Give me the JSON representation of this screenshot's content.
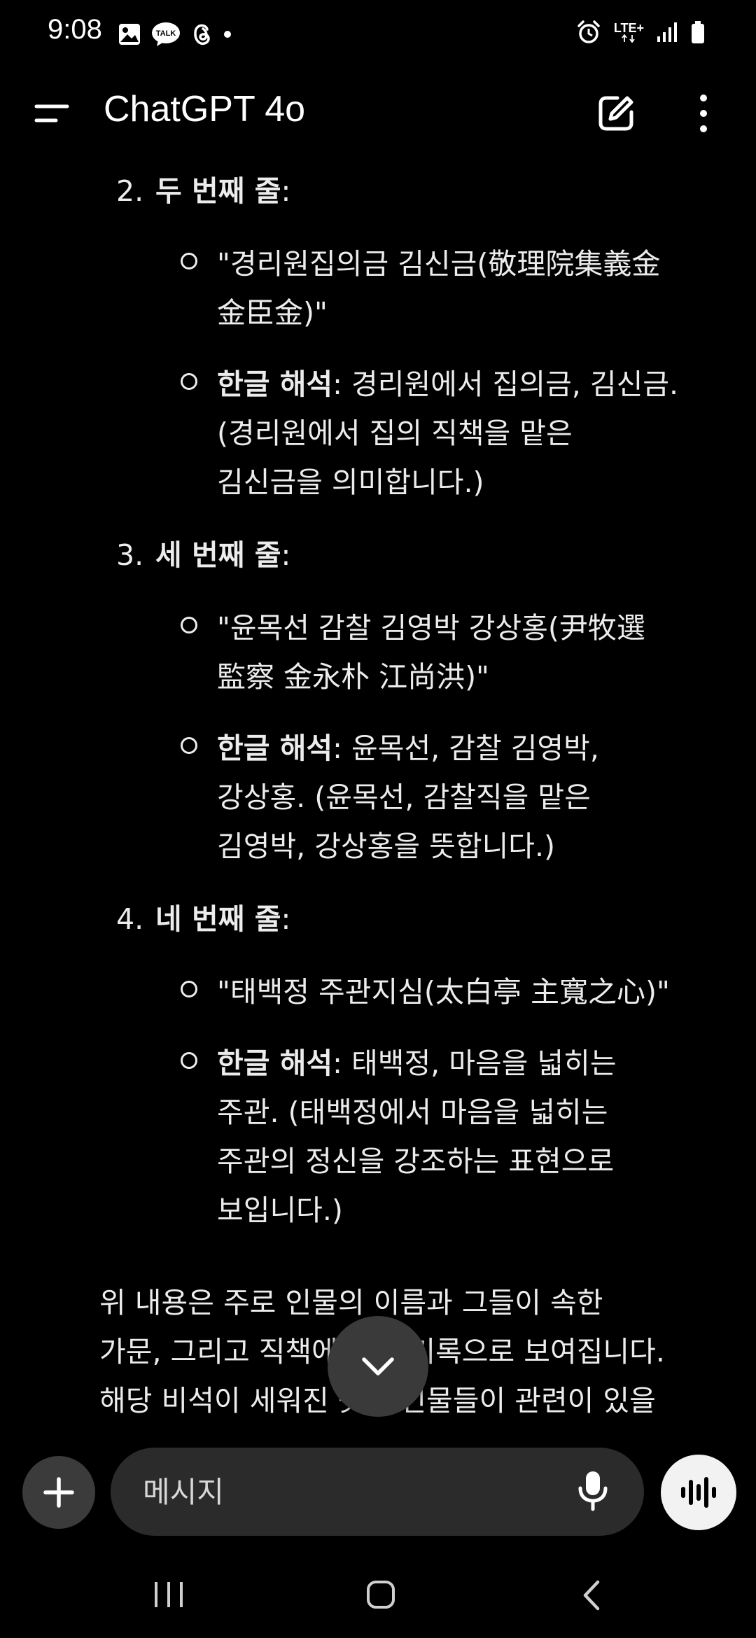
{
  "status_bar": {
    "time": "9:08",
    "left_icons": [
      "gallery-icon",
      "talk-icon",
      "threads-icon",
      "dot-icon"
    ],
    "talk_badge": "TALK",
    "network": "LTE+",
    "right_icons": [
      "alarm-icon",
      "lte-icon",
      "signal-icon",
      "battery-icon"
    ]
  },
  "app_bar": {
    "title": "ChatGPT 4o",
    "icons": [
      "menu-icon",
      "new-chat-icon",
      "more-vert-icon"
    ]
  },
  "message": {
    "items": [
      {
        "number": "2.",
        "heading": "두 번째 줄",
        "suffix": ":",
        "quote_lines": [
          "\"경리원집의금 김신금(敬理院集義金",
          "金臣金)\""
        ],
        "interp_label": "한글 해석",
        "interp_lines": [
          ": 경리원에서 집의금, 김신금.",
          "(경리원에서 집의 직책을 맡은",
          "김신금을 의미합니다.)"
        ]
      },
      {
        "number": "3.",
        "heading": "세 번째 줄",
        "suffix": ":",
        "quote_lines": [
          "\"윤목선 감찰 김영박 강상홍(尹牧選",
          "監察 金永朴 江尚洪)\""
        ],
        "interp_label": "한글 해석",
        "interp_lines": [
          ": 윤목선, 감찰 김영박,",
          "강상홍. (윤목선, 감찰직을 맡은",
          "김영박, 강상홍을 뜻합니다.)"
        ]
      },
      {
        "number": "4.",
        "heading": "네 번째 줄",
        "suffix": ":",
        "quote_lines": [
          "\"태백정 주관지심(太白亭 主寬之心)\""
        ],
        "interp_label": "한글 해석",
        "interp_lines": [
          ": 태백정, 마음을 넓히는",
          "주관. (태백정에서 마음을 넓히는",
          "주관의 정신을 강조하는 표현으로",
          "보입니다.)"
        ]
      }
    ],
    "summary_lines": [
      "위 내용은 주로 인물의 이름과 그들이 속한",
      "가문, 그리고 직책에 대한 기록으로 보여집니다.",
      "해당 비석이 세워진 곳과 인물들이 관련이 있을"
    ]
  },
  "scroll_button_icon": "chevron-down-icon",
  "composer": {
    "plus_icon": "plus-icon",
    "placeholder": "메시지",
    "mic_icon": "mic-icon",
    "voice_icon": "voice-wave-icon"
  },
  "nav_bar": {
    "icons": [
      "recents-icon",
      "home-icon",
      "back-icon"
    ]
  },
  "colors": {
    "background": "#000000",
    "text": "#ececec",
    "input_bg": "#2b2b2b",
    "button_bg": "#3b3b3b",
    "voice_button_bg": "#f2f2f2"
  }
}
